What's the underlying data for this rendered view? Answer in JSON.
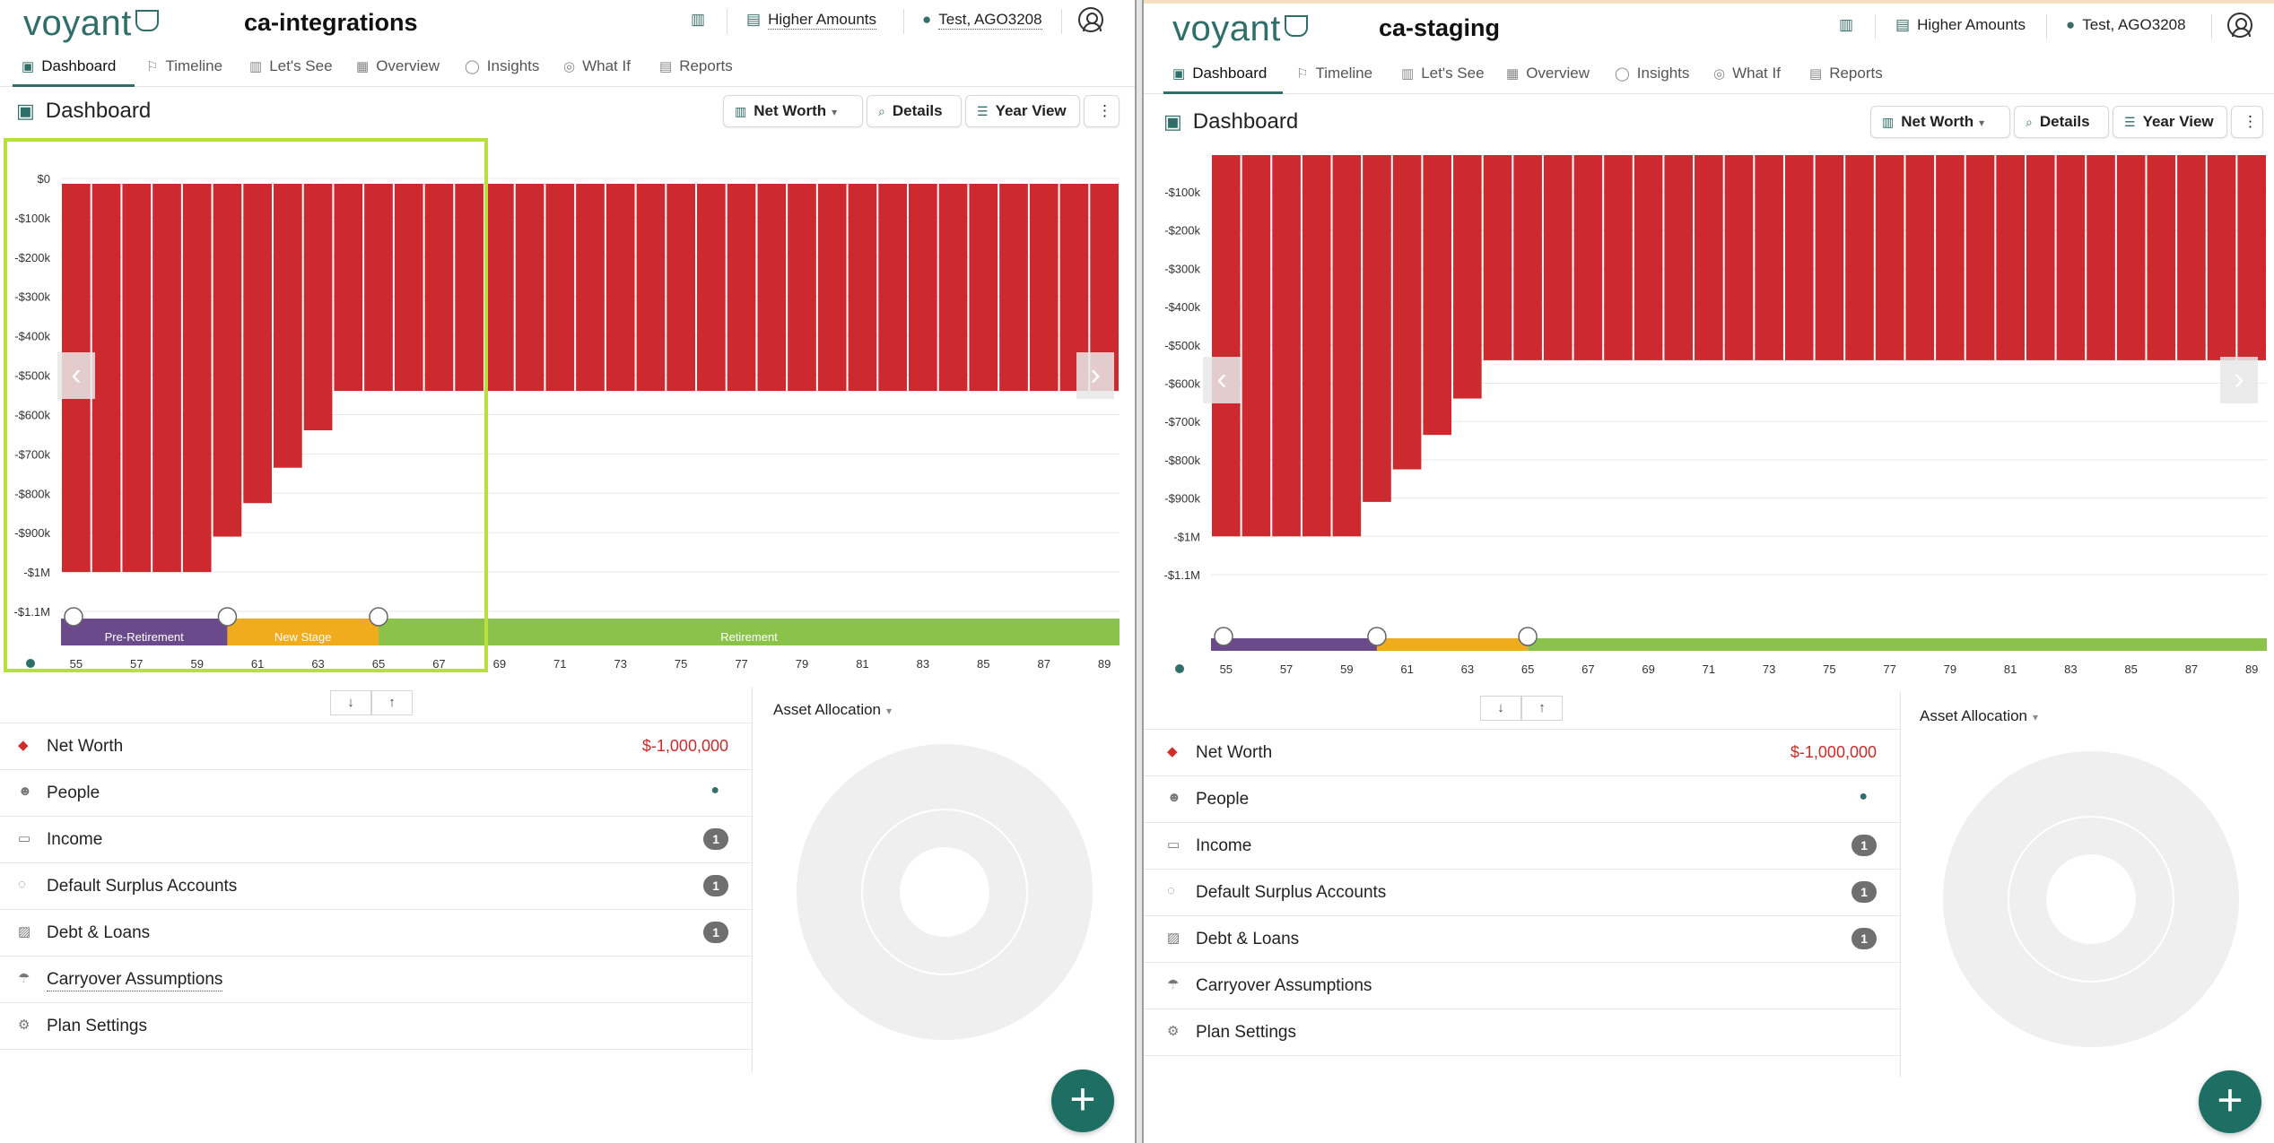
{
  "brand": {
    "logo_text": "voyant"
  },
  "colors": {
    "bar": "#cc2a2e",
    "pre_retirement": "#6b4a8c",
    "new_stage": "#f0ac1c",
    "retirement": "#8bc34a",
    "accent": "#2f6f6a",
    "highlight": "#b7e03a"
  },
  "nav": {
    "tabs": [
      {
        "label": "Dashboard",
        "icon": "dashboard-icon"
      },
      {
        "label": "Timeline",
        "icon": "flag-icon"
      },
      {
        "label": "Let's See",
        "icon": "bar-chart-icon"
      },
      {
        "label": "Overview",
        "icon": "overview-icon"
      },
      {
        "label": "Insights",
        "icon": "lightbulb-icon"
      },
      {
        "label": "What If",
        "icon": "compass-icon"
      },
      {
        "label": "Reports",
        "icon": "report-icon"
      }
    ]
  },
  "dashboard": {
    "title": "Dashboard",
    "controls": {
      "chart_type": "Net Worth",
      "details": "Details",
      "year_view": "Year View",
      "more": "⋮"
    }
  },
  "summary": {
    "rows": [
      {
        "label": "Net Worth",
        "icon": "gem-icon",
        "value": "$-1,000,000"
      },
      {
        "label": "People",
        "icon": "people-icon"
      },
      {
        "label": "Income",
        "icon": "income-icon",
        "badge": "1"
      },
      {
        "label": "Default Surplus Accounts",
        "icon": "piggy-icon",
        "badge": "1"
      },
      {
        "label": "Debt & Loans",
        "icon": "debt-icon",
        "badge": "1"
      },
      {
        "label": "Carryover Assumptions",
        "icon": "umbrella-icon"
      },
      {
        "label": "Plan Settings",
        "icon": "gear-icon"
      }
    ],
    "asset_allocation": "Asset Allocation"
  },
  "panes": {
    "left": {
      "env_name": "ca-integrations",
      "scenario": "Higher Amounts",
      "user": "Test, AGO3208",
      "stages": [
        "Pre-Retirement",
        "New Stage",
        "Retirement"
      ]
    },
    "right": {
      "env_name": "ca-staging",
      "scenario": "Higher Amounts",
      "user": "Test, AGO3208",
      "stages": []
    }
  },
  "chart_data": [
    {
      "type": "bar",
      "title": "",
      "x_tick_labels": [
        "55",
        "57",
        "59",
        "61",
        "63",
        "65",
        "67",
        "69",
        "71",
        "73",
        "75",
        "77",
        "79",
        "81",
        "83",
        "85",
        "87",
        "89"
      ],
      "x": [
        55,
        56,
        57,
        58,
        59,
        60,
        61,
        62,
        63,
        64,
        65,
        66,
        67,
        68,
        69,
        70,
        71,
        72,
        73,
        74,
        75,
        76,
        77,
        78,
        79,
        80,
        81,
        82,
        83,
        84,
        85,
        86,
        87,
        88,
        89
      ],
      "values": [
        -1000000,
        -1000000,
        -1000000,
        -1000000,
        -1000000,
        -910000,
        -825000,
        -735000,
        -640000,
        -540000,
        -540000,
        -540000,
        -540000,
        -540000,
        -540000,
        -540000,
        -540000,
        -540000,
        -540000,
        -540000,
        -540000,
        -540000,
        -540000,
        -540000,
        -540000,
        -540000,
        -540000,
        -540000,
        -540000,
        -540000,
        -540000,
        -540000,
        -540000,
        -540000,
        -540000
      ],
      "y_tick_labels": [
        "$0",
        "-$100k",
        "-$200k",
        "-$300k",
        "-$400k",
        "-$500k",
        "-$600k",
        "-$700k",
        "-$800k",
        "-$900k",
        "-$1M",
        "-$1.1M"
      ],
      "ylim": [
        -1100000,
        0
      ],
      "grid": true
    },
    {
      "type": "bar",
      "title": "",
      "x_tick_labels": [
        "55",
        "57",
        "59",
        "61",
        "63",
        "65",
        "67",
        "69",
        "71",
        "73",
        "75",
        "77",
        "79",
        "81",
        "83",
        "85",
        "87",
        "89"
      ],
      "x": [
        55,
        56,
        57,
        58,
        59,
        60,
        61,
        62,
        63,
        64,
        65,
        66,
        67,
        68,
        69,
        70,
        71,
        72,
        73,
        74,
        75,
        76,
        77,
        78,
        79,
        80,
        81,
        82,
        83,
        84,
        85,
        86,
        87,
        88,
        89
      ],
      "values": [
        -1000000,
        -1000000,
        -1000000,
        -1000000,
        -1000000,
        -910000,
        -825000,
        -735000,
        -640000,
        -540000,
        -540000,
        -540000,
        -540000,
        -540000,
        -540000,
        -540000,
        -540000,
        -540000,
        -540000,
        -540000,
        -540000,
        -540000,
        -540000,
        -540000,
        -540000,
        -540000,
        -540000,
        -540000,
        -540000,
        -540000,
        -540000,
        -540000,
        -540000,
        -540000,
        -540000
      ],
      "y_tick_labels": [
        "-$100k",
        "-$200k",
        "-$300k",
        "-$400k",
        "-$500k",
        "-$600k",
        "-$700k",
        "-$800k",
        "-$900k",
        "-$1M",
        "-$1.1M"
      ],
      "ylim": [
        -1100000,
        -100000
      ],
      "grid": true
    }
  ]
}
